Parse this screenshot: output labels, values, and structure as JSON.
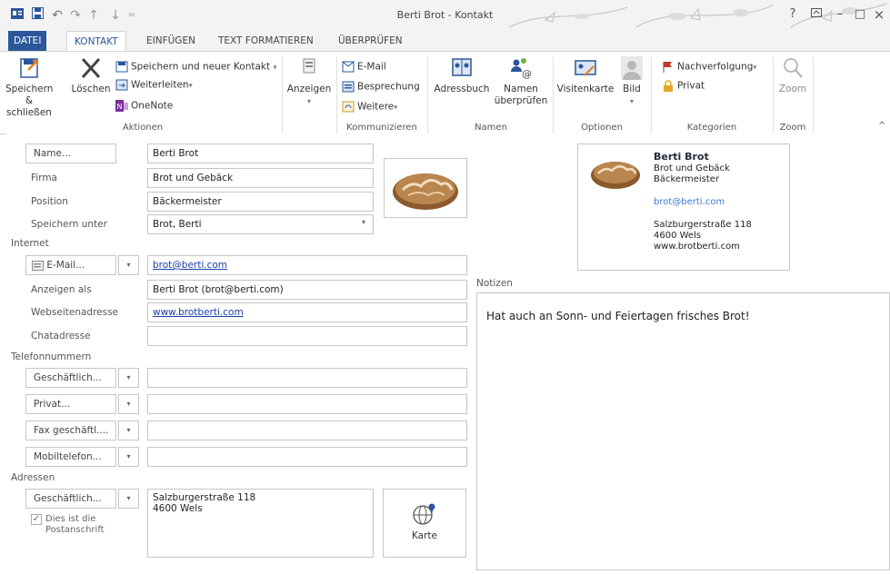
{
  "window": {
    "title": "Berti Brot - Kontakt",
    "help": "?",
    "minimize": "–",
    "maximize": "□",
    "close": "×"
  },
  "tabs": [
    "DATEI",
    "KONTAKT",
    "EINFÜGEN",
    "TEXT FORMATIEREN",
    "ÜBERPRÜFEN"
  ],
  "ribbon": {
    "aktionen": {
      "label": "Aktionen",
      "save_close_1": "Speichern",
      "save_close_2": "& schließen",
      "delete": "Löschen",
      "save_new": "Speichern und neuer Kontakt",
      "forward": "Weiterleiten",
      "onenote": "OneNote"
    },
    "anzeigen": {
      "label": "Anzeigen"
    },
    "kommunizieren": {
      "label": "Kommunizieren",
      "email": "E-Mail",
      "meeting": "Besprechung",
      "more": "Weitere"
    },
    "namen": {
      "label": "Namen",
      "addressbook": "Adressbuch",
      "check_1": "Namen",
      "check_2": "überprüfen"
    },
    "optionen": {
      "label": "Optionen",
      "card": "Visitenkarte",
      "picture": "Bild"
    },
    "kategorien": {
      "label": "Kategorien",
      "followup": "Nachverfolgung",
      "private": "Privat"
    },
    "zoom": {
      "label": "Zoom",
      "zoom": "Zoom"
    }
  },
  "form": {
    "name_btn": "Name...",
    "name": "Berti Brot",
    "company_label": "Firma",
    "company": "Brot und Gebäck",
    "position_label": "Position",
    "position": "Bäckermeister",
    "file_as_label": "Speichern unter",
    "file_as": "Brot, Berti",
    "internet_section": "Internet",
    "email_btn": "E-Mail...",
    "email": "brot@berti.com",
    "display_as_label": "Anzeigen als",
    "display_as": "Berti Brot (brot@berti.com)",
    "web_label": "Webseitenadresse",
    "web": "www.brotberti.com",
    "im_label": "Chatadresse",
    "im": "",
    "phone_section": "Telefonnummern",
    "phone1_btn": "Geschäftlich...",
    "phone2_btn": "Privat...",
    "phone3_btn": "Fax geschäftl....",
    "phone4_btn": "Mobiltelefon...",
    "address_section": "Adressen",
    "address_btn": "Geschäftlich...",
    "address_line1": "Salzburgerstraße 118",
    "address_line2": "4600 Wels",
    "mailing_1": "Dies ist die",
    "mailing_2": "Postanschrift",
    "map_label": "Karte",
    "notes_label": "Notizen",
    "notes": "Hat auch an Sonn- und Feiertagen frisches Brot!"
  },
  "card": {
    "name": "Berti Brot",
    "company": "Brot und Gebäck",
    "position": "Bäckermeister",
    "email": "brot@berti.com",
    "street": "Salzburgerstraße 118",
    "city": "4600 Wels",
    "web": "www.brotberti.com"
  },
  "colors": {
    "accent": "#2b579a",
    "link": "#1a3fa8",
    "flag": "#c0392b"
  },
  "icons": [
    "save-close-icon",
    "delete-icon",
    "save-new-icon",
    "forward-icon",
    "onenote-icon",
    "show-icon",
    "email-icon",
    "meeting-icon",
    "more-icon",
    "addressbook-icon",
    "check-names-icon",
    "business-card-icon",
    "picture-icon",
    "flag-icon",
    "lock-icon",
    "zoom-icon",
    "globe-icon",
    "bread-photo"
  ]
}
